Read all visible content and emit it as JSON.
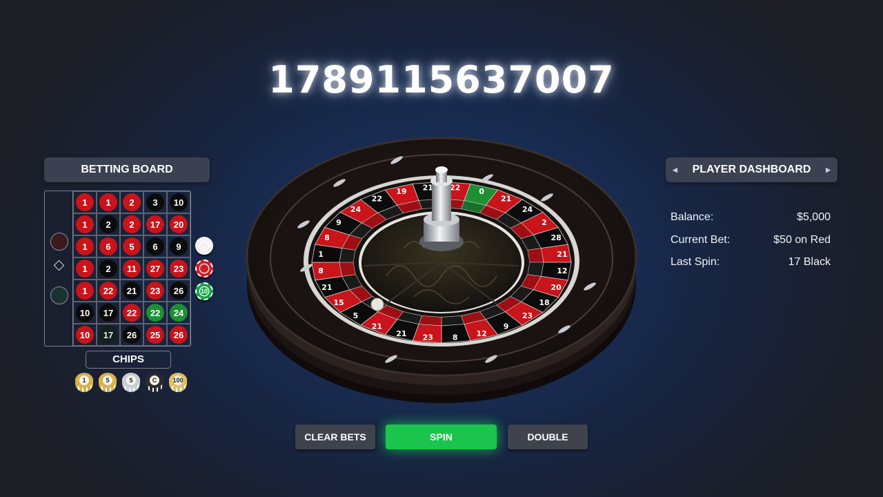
{
  "headline": {
    "value": "1789115637007"
  },
  "betting_board": {
    "title": "BETTING BOARD",
    "rows": [
      [
        {
          "n": "1",
          "c": "red"
        },
        {
          "n": "1",
          "c": "red"
        },
        {
          "n": "2",
          "c": "red"
        },
        {
          "n": "3",
          "c": "black"
        },
        {
          "n": "10",
          "c": "black"
        }
      ],
      [
        {
          "n": "1",
          "c": "red"
        },
        {
          "n": "2",
          "c": "black"
        },
        {
          "n": "2",
          "c": "red"
        },
        {
          "n": "17",
          "c": "red"
        },
        {
          "n": "20",
          "c": "red"
        }
      ],
      [
        {
          "n": "1",
          "c": "red"
        },
        {
          "n": "6",
          "c": "red"
        },
        {
          "n": "5",
          "c": "red"
        },
        {
          "n": "6",
          "c": "black"
        },
        {
          "n": "9",
          "c": "black"
        }
      ],
      [
        {
          "n": "1",
          "c": "red"
        },
        {
          "n": "2",
          "c": "black"
        },
        {
          "n": "11",
          "c": "red"
        },
        {
          "n": "27",
          "c": "red"
        },
        {
          "n": "23",
          "c": "red"
        }
      ],
      [
        {
          "n": "1",
          "c": "red"
        },
        {
          "n": "22",
          "c": "red"
        },
        {
          "n": "21",
          "c": "black"
        },
        {
          "n": "23",
          "c": "red"
        },
        {
          "n": "26",
          "c": "black"
        }
      ],
      [
        {
          "n": "10",
          "c": "black"
        },
        {
          "n": "17",
          "c": "black"
        },
        {
          "n": "22",
          "c": "red"
        },
        {
          "n": "22",
          "c": "green"
        },
        {
          "n": "24",
          "c": "green"
        }
      ],
      [
        {
          "n": "10",
          "c": "red"
        },
        {
          "n": "17",
          "c": "dark"
        },
        {
          "n": "26",
          "c": "black"
        },
        {
          "n": "25",
          "c": "red"
        },
        {
          "n": "26",
          "c": "red"
        }
      ]
    ],
    "side_markers": [
      "red-circle-icon",
      "diamond-icon",
      "green-circle-icon"
    ],
    "placed_chips": [
      {
        "icon": "white-chip-icon",
        "color": "#f2f2f2"
      },
      {
        "icon": "red-chip-icon",
        "color": "#d21f2a",
        "label": ""
      },
      {
        "icon": "green-chip-icon",
        "color": "#17a34a",
        "label": "10"
      }
    ]
  },
  "chips": {
    "label": "CHIPS",
    "items": [
      {
        "label": "1",
        "color": "#d9b24a"
      },
      {
        "label": "5",
        "color": "#d9b24a"
      },
      {
        "label": "5",
        "color": "#c9cdd4"
      },
      {
        "label": "C",
        "color": "#2a2b2f"
      },
      {
        "label": "100",
        "color": "#e0c060"
      }
    ]
  },
  "dashboard": {
    "title": "PLAYER DASHBOARD",
    "rows": [
      {
        "label": "Balance:",
        "value": "$5,000"
      },
      {
        "label": "Current Bet:",
        "value": "$50 on Red"
      },
      {
        "label": "Last Spin:",
        "value": "17 Black"
      }
    ]
  },
  "wheel": {
    "pocket_labels": [
      "22",
      "0",
      "21",
      "24",
      "2",
      "28",
      "21",
      "12",
      "20",
      "18",
      "23",
      "9",
      "12",
      "8",
      "23",
      "21",
      "21",
      "5",
      "15",
      "21",
      "8",
      "1",
      "8",
      "9",
      "24",
      "22",
      "19",
      "21"
    ]
  },
  "buttons": {
    "clear": "CLEAR BETS",
    "spin": "SPIN",
    "double": "DOUBLE"
  },
  "colors": {
    "red": "#c8141a",
    "black": "#0b0b0c",
    "green": "#1e8f33",
    "spin_button": "#1bc44d"
  }
}
